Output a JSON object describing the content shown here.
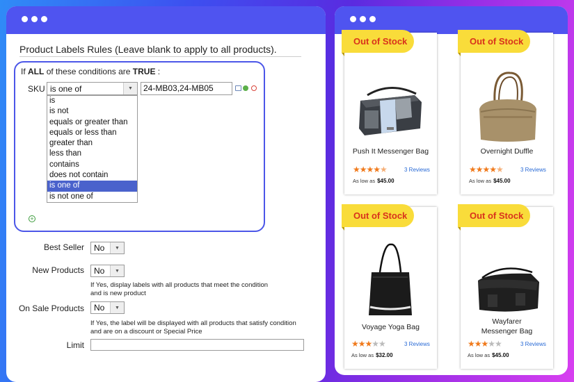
{
  "left_panel": {
    "title": "Product Labels Rules (Leave blank to apply to all products).",
    "condition": {
      "prefix": "If",
      "all": "ALL",
      "middle": "of these conditions are",
      "truth": "TRUE",
      "suffix": ":",
      "sku_label": "SKU",
      "operator_selected": "is one of",
      "sku_value": "24-MB03,24-MB05",
      "operator_options": [
        "is",
        "is not",
        "equals or greater than",
        "equals or less than",
        "greater than",
        "less than",
        "contains",
        "does not contain",
        "is one of",
        "is not one of"
      ],
      "selected_index": 8
    },
    "best_seller": {
      "label": "Best Seller",
      "value": "No"
    },
    "new_products": {
      "label": "New Products",
      "value": "No",
      "note_line1": "If Yes, display labels with all products that meet the condition",
      "note_line2": "and is new product"
    },
    "on_sale": {
      "label": "On Sale Products",
      "value": "No",
      "note_line1": "If Yes, the label will be displayed with all products that satisfy condition",
      "note_line2": "and are on a discount or Special Price"
    },
    "limit": {
      "label": "Limit",
      "value": ""
    }
  },
  "products": [
    {
      "badge": "Out of Stock",
      "name_line1": "Push It Messenger Bag",
      "name_line2": "",
      "rating": 4.5,
      "reviews": "3  Reviews",
      "price_prefix": "As low as",
      "price": "$45.00"
    },
    {
      "badge": "Out of Stock",
      "name_line1": "Overnight Duffle",
      "name_line2": "",
      "rating": 4.5,
      "reviews": "3  Reviews",
      "price_prefix": "As low as",
      "price": "$45.00"
    },
    {
      "badge": "Out of Stock",
      "name_line1": "Voyage Yoga Bag",
      "name_line2": "",
      "rating": 3,
      "reviews": "3  Reviews",
      "price_prefix": "As low as",
      "price": "$32.00"
    },
    {
      "badge": "Out of Stock",
      "name_line1": "Wayfarer",
      "name_line2": "Messenger Bag",
      "rating": 3,
      "reviews": "3  Reviews",
      "price_prefix": "As low as",
      "price": "$45.00"
    }
  ],
  "colors": {
    "accent": "#4f54f0",
    "badge_bg": "#f9dc3a",
    "badge_text": "#d9321c",
    "star": "#f07a1c",
    "review_link": "#2a6bd6",
    "selected_option": "#4a62cc"
  },
  "icons": [
    "window-dots-icon",
    "calendar-icon",
    "apply-icon",
    "remove-icon",
    "add-condition-icon",
    "dropdown-arrow-icon",
    "star-icon"
  ]
}
